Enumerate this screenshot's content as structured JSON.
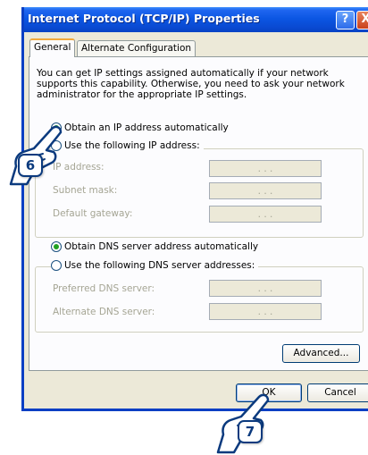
{
  "window": {
    "title": "Internet Protocol (TCP/IP) Properties",
    "help_glyph": "?",
    "close_glyph": "X"
  },
  "tabs": [
    {
      "label": "General",
      "selected": true
    },
    {
      "label": "Alternate Configuration",
      "selected": false
    }
  ],
  "intro_text": "You can get IP settings assigned automatically if your network supports this capability. Otherwise, you need to ask your network administrator for the appropriate IP settings.",
  "ip_mode": {
    "auto_label": "Obtain an IP address automatically",
    "manual_label": "Use the following IP address:",
    "selected": "auto"
  },
  "ip_fields": [
    {
      "label": "IP address:",
      "value": ". . ."
    },
    {
      "label": "Subnet mask:",
      "value": ". . ."
    },
    {
      "label": "Default gateway:",
      "value": ". . ."
    }
  ],
  "dns_mode": {
    "auto_label": "Obtain DNS server address automatically",
    "manual_label": "Use the following DNS server addresses:",
    "selected": "auto"
  },
  "dns_fields": [
    {
      "label": "Preferred DNS server:",
      "value": ". . ."
    },
    {
      "label": "Alternate DNS server:",
      "value": ". . ."
    }
  ],
  "buttons": {
    "advanced": "Advanced...",
    "ok": "OK",
    "cancel": "Cancel"
  },
  "callouts": {
    "step_a": "6",
    "step_b": "7"
  },
  "colors": {
    "title_bar": "#0b56e3",
    "dialog_bg": "#ece9d8",
    "radio_dot": "#21a121",
    "callout_border": "#0b3a7e"
  }
}
